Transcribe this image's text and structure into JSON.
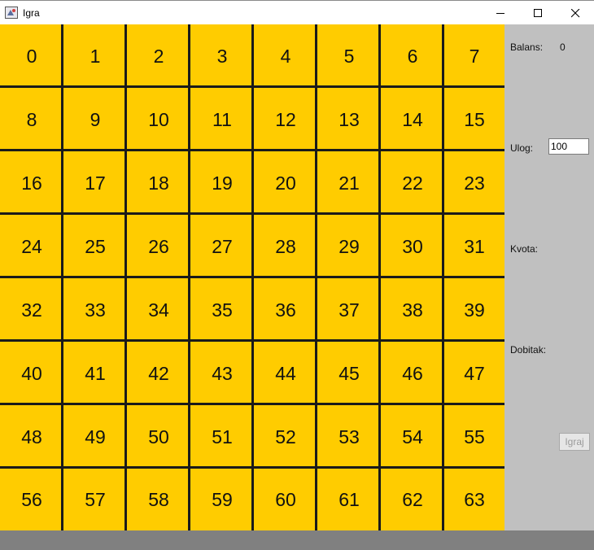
{
  "window": {
    "title": "Igra",
    "minimize_icon": "minimize-icon",
    "maximize_icon": "maximize-icon",
    "close_icon": "close-icon"
  },
  "grid": {
    "cell_color": "#ffcc00",
    "line_color": "#1a1a1a",
    "cells": [
      "0",
      "1",
      "2",
      "3",
      "4",
      "5",
      "6",
      "7",
      "8",
      "9",
      "10",
      "11",
      "12",
      "13",
      "14",
      "15",
      "16",
      "17",
      "18",
      "19",
      "20",
      "21",
      "22",
      "23",
      "24",
      "25",
      "26",
      "27",
      "28",
      "29",
      "30",
      "31",
      "32",
      "33",
      "34",
      "35",
      "36",
      "37",
      "38",
      "39",
      "40",
      "41",
      "42",
      "43",
      "44",
      "45",
      "46",
      "47",
      "48",
      "49",
      "50",
      "51",
      "52",
      "53",
      "54",
      "55",
      "56",
      "57",
      "58",
      "59",
      "60",
      "61",
      "62",
      "63"
    ]
  },
  "panel": {
    "balance_label": "Balans:",
    "balance_value": "0",
    "stake_label": "Ulog:",
    "stake_value": "100",
    "odds_label": "Kvota:",
    "winnings_label": "Dobitak:",
    "play_button": "Igraj",
    "background": "#c0c0c0"
  }
}
